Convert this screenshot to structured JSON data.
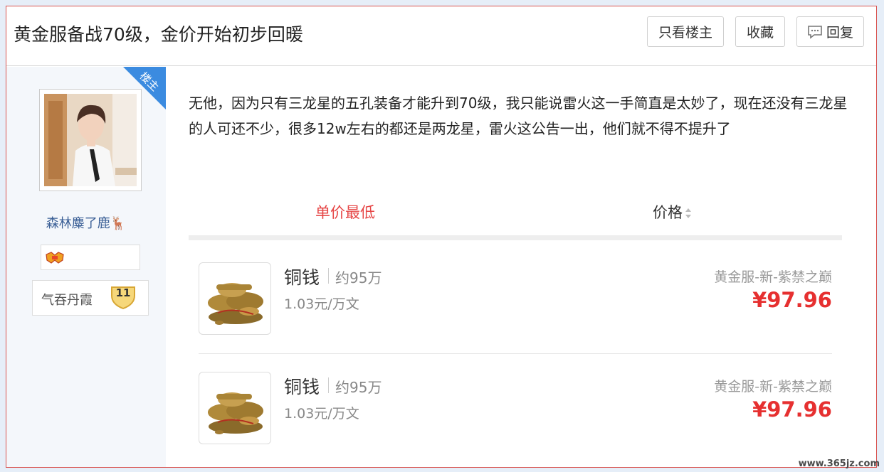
{
  "header": {
    "title": "黄金服备战70级，金价开始初步回暖",
    "only_op_label": "只看楼主",
    "favorite_label": "收藏",
    "reply_label": "回复"
  },
  "author": {
    "op_badge": "楼主",
    "username": "森林麋了鹿",
    "username_emoji": "🦌",
    "level_name": "气吞丹霞",
    "level": "11"
  },
  "post": {
    "body": "无他，因为只有三龙星的五孔装备才能升到70级，我只能说雷火这一手简直是太妙了，现在还没有三龙星的人可还不少，很多12w左右的都还是两龙星，雷火这公告一出，他们就不得不提升了"
  },
  "sort_tabs": {
    "lowest_unit_price": "单价最低",
    "price": "价格"
  },
  "listings": [
    {
      "name": "铜钱",
      "quantity": "约95万",
      "unit_price": "1.03元/万文",
      "server": "黄金服-新-紫禁之巅",
      "price": "¥97.96"
    },
    {
      "name": "铜钱",
      "quantity": "约95万",
      "unit_price": "1.03元/万文",
      "server": "黄金服-新-紫禁之巅",
      "price": "¥97.96"
    }
  ],
  "watermark": "www.365jz.com",
  "colors": {
    "accent_red": "#e63030",
    "badge_blue": "#3b8be0",
    "username_blue": "#3a5f96"
  }
}
